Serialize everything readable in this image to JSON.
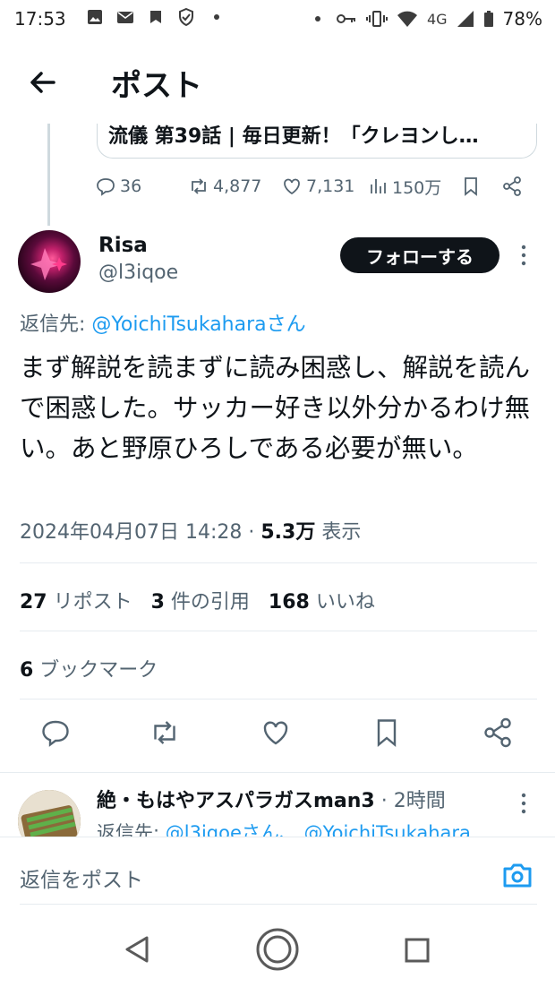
{
  "status_bar": {
    "time": "17:53",
    "network": "4G",
    "battery": "78%",
    "sim": "5"
  },
  "header": {
    "title": "ポスト"
  },
  "quoted": {
    "text": "流儀 第39話 | 毎日更新！「クレヨンし…"
  },
  "prev_actions": {
    "replies": "36",
    "reposts": "4,877",
    "likes": "7,131",
    "views": "150万"
  },
  "post": {
    "name": "Risa",
    "handle": "@l3iqoe",
    "follow_label": "フォローする",
    "reply_prefix": "返信先: ",
    "reply_user": "@YoichiTsukahara",
    "reply_suffix": "さん",
    "text": "まず解説を読まずに読み困惑し、解説を読んで困惑した。サッカー好き以外分かるわけ無い。あと野原ひろしである必要が無い。",
    "date": "2024年04月07日 14:28 · ",
    "views": "5.3万",
    "views_label": " 表示",
    "reposts_count": "27",
    "reposts_label": " リポスト",
    "quotes_count": "3",
    "quotes_label": " 件の引用",
    "likes_count": "168",
    "likes_label": " いいね",
    "bookmarks_count": "6",
    "bookmarks_label": " ブックマーク"
  },
  "next_reply": {
    "name": "絶・もはやアスパラガスman3",
    "time": " · 2時間",
    "reply_prefix": "返信先: ",
    "reply_users": "@l3iqoeさん、 @YoichiTsukahara"
  },
  "composer": {
    "placeholder": "返信をポスト"
  },
  "icons": {
    "back": "arrow-left-icon",
    "reply": "reply-icon",
    "repost": "repost-icon",
    "like": "heart-icon",
    "views": "views-icon",
    "bookmark": "bookmark-icon",
    "share": "share-icon",
    "camera": "camera-icon"
  },
  "colors": {
    "accent": "#1d9bf0",
    "text": "#0f1419",
    "muted": "#536471",
    "follow_bg": "#0f1419"
  }
}
